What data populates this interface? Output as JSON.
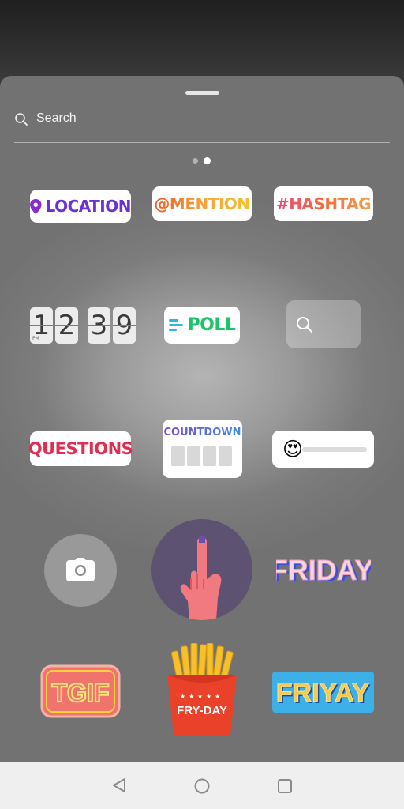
{
  "search": {
    "placeholder": "Search"
  },
  "pager": {
    "pages": 2,
    "active": 2
  },
  "stickers": {
    "location": "LOCATION",
    "mention": "@MENTION",
    "hashtag": "#HASHTAG",
    "clock": {
      "ampm": "PM",
      "digits": [
        "1",
        "2",
        "3",
        "9"
      ]
    },
    "poll": "POLL",
    "questions": "QUESTIONS",
    "countdown": "COUNTDOWN",
    "slider_emoji": "😍",
    "friday": "FRIDAY",
    "tgif": "TGIF",
    "fryday": "FRY-DAY",
    "friyay": "FRIYAY"
  },
  "icons": {
    "search": "search-icon",
    "location": "location-pin-icon",
    "camera": "camera-icon",
    "back": "back-icon",
    "home": "home-icon",
    "recents": "recents-icon"
  },
  "colors": {
    "location": "#6d2fd6",
    "poll": "#1ec46a",
    "questions": "#e02d54",
    "navbar": "#efefef"
  }
}
